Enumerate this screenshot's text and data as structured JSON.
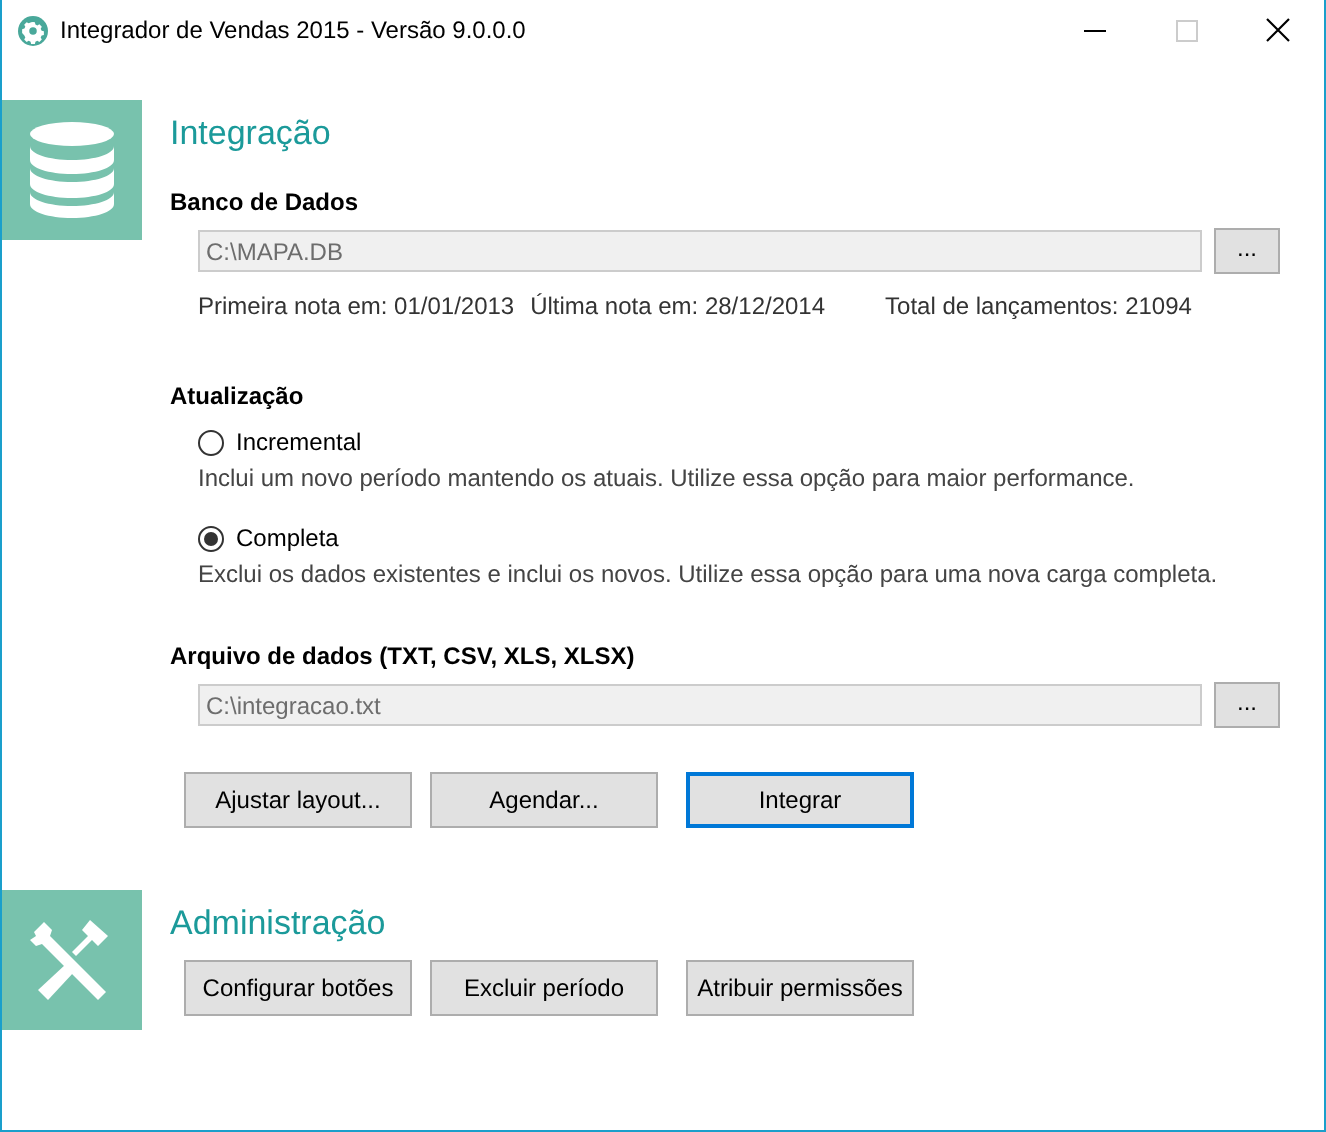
{
  "window": {
    "title": "Integrador de Vendas 2015 - Versão 9.0.0.0",
    "controls": [
      {
        "kind": "minimize",
        "disabled": false
      },
      {
        "kind": "maximize",
        "disabled": true
      },
      {
        "kind": "close",
        "disabled": false
      }
    ]
  },
  "integration": {
    "title": "Integração",
    "database": {
      "label": "Banco de Dados",
      "path": "C:\\MAPA.DB",
      "browse": "...",
      "info": [
        "Primeira nota em: 01/01/2013",
        "Última nota em: 28/12/2014",
        "Total de lançamentos: 21094"
      ]
    },
    "update": {
      "label": "Atualização",
      "options": [
        {
          "label": "Incremental",
          "description": "Inclui um novo período mantendo os atuais. Utilize essa opção para maior performance.",
          "selected": false
        },
        {
          "label": "Completa",
          "description": "Exclui os dados existentes e inclui os novos. Utilize essa opção para uma nova carga completa.",
          "selected": true
        }
      ]
    },
    "data_file": {
      "label": "Arquivo de dados (TXT, CSV, XLS, XLSX)",
      "path": "C:\\integracao.txt",
      "browse": "..."
    },
    "buttons": [
      {
        "label": "Ajustar layout...",
        "focused": false
      },
      {
        "label": "Agendar...",
        "focused": false
      },
      {
        "label": "Integrar",
        "focused": true
      }
    ]
  },
  "administration": {
    "title": "Administração",
    "buttons": [
      {
        "label": "Configurar botões",
        "focused": false
      },
      {
        "label": "Excluir período",
        "focused": false
      },
      {
        "label": "Atribuir permissões",
        "focused": false
      }
    ]
  }
}
